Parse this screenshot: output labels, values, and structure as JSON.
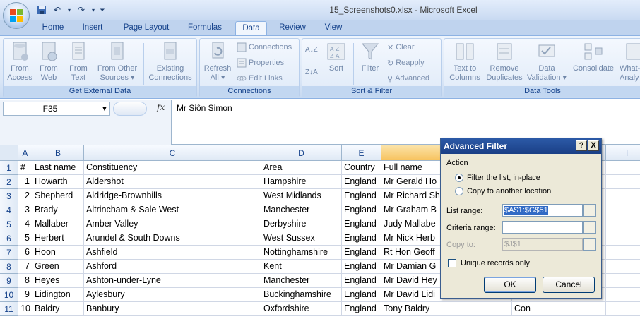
{
  "window": {
    "title": "15_Screenshots0.xlsx - Microsoft Excel"
  },
  "quick_access": {
    "items": [
      "save-icon",
      "undo-icon",
      "redo-icon",
      "customize-icon"
    ]
  },
  "tabs": [
    {
      "label": "Home",
      "active": false
    },
    {
      "label": "Insert",
      "active": false
    },
    {
      "label": "Page Layout",
      "active": false
    },
    {
      "label": "Formulas",
      "active": false
    },
    {
      "label": "Data",
      "active": true
    },
    {
      "label": "Review",
      "active": false
    },
    {
      "label": "View",
      "active": false
    }
  ],
  "ribbon": {
    "external_data": {
      "label": "Get External Data",
      "from_access": [
        "From",
        "Access"
      ],
      "from_web": [
        "From",
        "Web"
      ],
      "from_text": [
        "From",
        "Text"
      ],
      "from_other": [
        "From Other",
        "Sources"
      ],
      "existing": [
        "Existing",
        "Connections"
      ]
    },
    "connections": {
      "label": "Connections",
      "refresh": [
        "Refresh",
        "All"
      ],
      "connections": "Connections",
      "properties": "Properties",
      "edit_links": "Edit Links"
    },
    "sort_filter": {
      "label": "Sort & Filter",
      "sort": "Sort",
      "filter": "Filter",
      "clear": "Clear",
      "reapply": "Reapply",
      "advanced": "Advanced"
    },
    "data_tools": {
      "label": "Data Tools",
      "text_to_columns": [
        "Text to",
        "Columns"
      ],
      "remove_duplicates": [
        "Remove",
        "Duplicates"
      ],
      "data_validation": [
        "Data",
        "Validation"
      ],
      "consolidate": "Consolidate",
      "what_if": [
        "What-",
        "Analy"
      ]
    }
  },
  "formula_bar": {
    "name_box": "F35",
    "fx": "fx",
    "value": "Mr Siôn Simon"
  },
  "grid": {
    "columns": [
      "A",
      "B",
      "C",
      "D",
      "E",
      "F",
      "G",
      "H",
      "I"
    ],
    "rows": [
      {
        "n": "1",
        "a": "#",
        "b": "Last name",
        "c": "Constituency",
        "d": "Area",
        "e": "Country",
        "f": "Full name",
        "g": ""
      },
      {
        "n": "2",
        "a": "1",
        "b": "Howarth",
        "c": "Aldershot",
        "d": "Hampshire",
        "e": "England",
        "f": "Mr Gerald Ho",
        "g": ""
      },
      {
        "n": "3",
        "a": "2",
        "b": "Shepherd",
        "c": "Aldridge-Brownhills",
        "d": "West Midlands",
        "e": "England",
        "f": "Mr Richard Sh",
        "g": ""
      },
      {
        "n": "4",
        "a": "3",
        "b": "Brady",
        "c": "Altrincham & Sale West",
        "d": "Manchester",
        "e": "England",
        "f": "Mr Graham B",
        "g": ""
      },
      {
        "n": "5",
        "a": "4",
        "b": "Mallaber",
        "c": "Amber Valley",
        "d": "Derbyshire",
        "e": "England",
        "f": "Judy Mallabe",
        "g": ""
      },
      {
        "n": "6",
        "a": "5",
        "b": "Herbert",
        "c": "Arundel & South Downs",
        "d": "West Sussex",
        "e": "England",
        "f": "Mr Nick Herb",
        "g": ""
      },
      {
        "n": "7",
        "a": "6",
        "b": "Hoon",
        "c": "Ashfield",
        "d": "Nottinghamshire",
        "e": "England",
        "f": "Rt Hon Geoff",
        "g": ""
      },
      {
        "n": "8",
        "a": "7",
        "b": "Green",
        "c": "Ashford",
        "d": "Kent",
        "e": "England",
        "f": "Mr Damian G",
        "g": ""
      },
      {
        "n": "9",
        "a": "8",
        "b": "Heyes",
        "c": "Ashton-under-Lyne",
        "d": "Manchester",
        "e": "England",
        "f": "Mr David Hey",
        "g": ""
      },
      {
        "n": "10",
        "a": "9",
        "b": "Lidington",
        "c": "Aylesbury",
        "d": "Buckinghamshire",
        "e": "England",
        "f": "Mr David Lidi",
        "g": ""
      },
      {
        "n": "11",
        "a": "10",
        "b": "Baldry",
        "c": "Banbury",
        "d": "Oxfordshire",
        "e": "England",
        "f": "Tony Baldry",
        "g": "Con"
      }
    ]
  },
  "dialog": {
    "title": "Advanced Filter",
    "help": "?",
    "close": "X",
    "action_label": "Action",
    "option_filter": "Filter the list, in-place",
    "option_copy": "Copy to another location",
    "list_range_label": "List range:",
    "list_range_value": "$A$1:$G$51",
    "criteria_range_label": "Criteria range:",
    "criteria_range_value": "",
    "copy_to_label": "Copy to:",
    "copy_to_value": "$J$1",
    "unique_label": "Unique records only",
    "ok": "OK",
    "cancel": "Cancel"
  }
}
